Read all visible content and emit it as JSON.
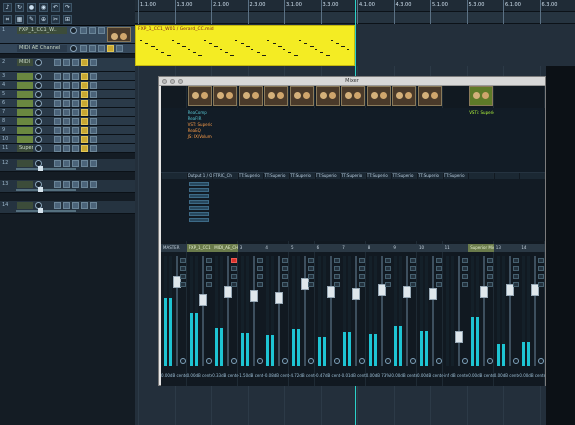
{
  "toolbar": {
    "icons": [
      "metronome-icon",
      "loop-icon",
      "punch-icon",
      "record-mode-icon",
      "undo-icon",
      "redo-icon",
      "snap-icon",
      "grid-icon",
      "tools-icon",
      "zoom-icon",
      "cut-icon",
      "glue-icon"
    ]
  },
  "tracks": [
    {
      "num": "1",
      "name": "FXP_1_CC1_W..",
      "type": "midi"
    },
    {
      "num": "",
      "name": "MIDI AE Channel",
      "type": "midi"
    },
    {
      "num": "2",
      "name": "MIDI",
      "type": "midi"
    },
    {
      "num": "3",
      "name": "",
      "type": "audio"
    },
    {
      "num": "4",
      "name": "",
      "type": "audio"
    },
    {
      "num": "5",
      "name": "",
      "type": "audio"
    },
    {
      "num": "6",
      "name": "",
      "type": "audio"
    },
    {
      "num": "7",
      "name": "",
      "type": "audio"
    },
    {
      "num": "8",
      "name": "",
      "type": "audio"
    },
    {
      "num": "9",
      "name": "",
      "type": "audio"
    },
    {
      "num": "10",
      "name": "",
      "type": "audio"
    },
    {
      "num": "11",
      "name": "Superio",
      "type": "audio"
    },
    {
      "num": "12",
      "name": "",
      "type": "bus"
    },
    {
      "num": "13",
      "name": "",
      "type": "bus"
    },
    {
      "num": "14",
      "name": "",
      "type": "bus"
    }
  ],
  "timeline": {
    "bars": [
      "1.1.00",
      "1.3.00",
      "2.1.00",
      "2.3.00",
      "3.1.00",
      "3.3.00",
      "4.1.00",
      "4.3.00",
      "5.1.00",
      "5.3.00",
      "6.1.00",
      "6.3.00"
    ],
    "clip_title": "FXP_1_CC1_W01 / Gerard_CC.mid"
  },
  "mixer": {
    "title": "Mixer",
    "strips": [
      {
        "name": "MASTER",
        "io": "",
        "vol": "0.00dB center",
        "fx": [],
        "head_style": "dark"
      },
      {
        "name": "FXP_1_CC1",
        "io": "Output 1 / Output 2",
        "vol": "0.00dB center",
        "fx": [
          "ReaComp",
          "ReaFIR",
          "VST: Superior",
          "ReaEQ",
          "JS: IX/Volume"
        ],
        "head_style": "green"
      },
      {
        "name": "MIDI_AE_CH",
        "io": "FTRIC_Ch",
        "vol": "0.33dB center",
        "fx": [],
        "head_style": "green"
      },
      {
        "name": "3",
        "io": "TT:Superio",
        "vol": "-1.50dB center",
        "fx": [],
        "head_style": "dark"
      },
      {
        "name": "4",
        "io": "TT:Superio",
        "vol": "-0.08dB center",
        "fx": [],
        "head_style": "dark"
      },
      {
        "name": "5",
        "io": "TT:Superio",
        "vol": "-4.72dB center",
        "fx": [],
        "head_style": "dark"
      },
      {
        "name": "6",
        "io": "TT:Superio",
        "vol": "-0.47dB center",
        "fx": [],
        "head_style": "dark"
      },
      {
        "name": "7",
        "io": "TT:Superio",
        "vol": "-0.01dB center",
        "fx": [],
        "head_style": "dark"
      },
      {
        "name": "8",
        "io": "TT:Superio",
        "vol": "0.00dB 73%R",
        "fx": [],
        "head_style": "dark"
      },
      {
        "name": "9",
        "io": "TT:Superio",
        "vol": "0.00dB center",
        "fx": [],
        "head_style": "dark"
      },
      {
        "name": "10",
        "io": "TT:Superio",
        "vol": "0.00dB center",
        "fx": [],
        "head_style": "dark"
      },
      {
        "name": "11",
        "io": "TT:Superio",
        "vol": "-inf dB center",
        "fx": [],
        "head_style": "dark"
      },
      {
        "name": "Superior Midi",
        "io": "",
        "vol": "0.00dB center",
        "fx": [
          "VSTi: Superior Dr"
        ],
        "head_style": "green"
      },
      {
        "name": "13",
        "io": "",
        "vol": "0.00dB center",
        "fx": [],
        "head_style": "dark"
      },
      {
        "name": "14",
        "io": "",
        "vol": "0.00dB center",
        "fx": [],
        "head_style": "dark"
      }
    ],
    "meter_levels": [
      0.62,
      0.48,
      0.35,
      0.3,
      0.28,
      0.34,
      0.26,
      0.31,
      0.29,
      0.36,
      0.32,
      0.0,
      0.45,
      0.2,
      0.22
    ],
    "fader_levels": [
      0.8,
      0.62,
      0.7,
      0.66,
      0.64,
      0.78,
      0.7,
      0.68,
      0.72,
      0.7,
      0.68,
      0.25,
      0.7,
      0.72,
      0.72
    ]
  }
}
